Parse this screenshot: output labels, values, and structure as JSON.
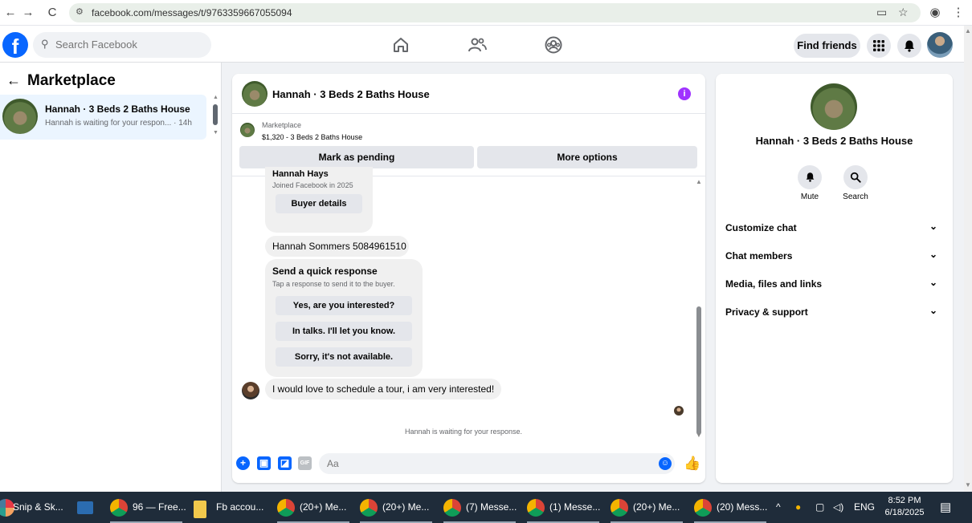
{
  "browser": {
    "url": "facebook.com/messages/t/9763359667055094"
  },
  "header": {
    "search_placeholder": "Search Facebook",
    "find_friends_label": "Find friends"
  },
  "sidebar": {
    "title": "Marketplace",
    "conversations": [
      {
        "name": "Hannah · 3 Beds 2 Baths House",
        "preview": "Hannah is waiting for your respon... · 14h"
      }
    ]
  },
  "chat": {
    "title": "Hannah · 3 Beds 2 Baths House",
    "marketplace_label": "Marketplace",
    "listing": "$1,320 - 3 Beds 2 Baths House",
    "mark_pending_label": "Mark as pending",
    "more_options_label": "More options",
    "profile_name": "Hannah Hays",
    "joined_text": "Joined Facebook in 2025",
    "buyer_details_label": "Buyer details",
    "phone_message": "Hannah Sommers 5084961510",
    "quick_title": "Send a quick response",
    "quick_subtitle": "Tap a response to send it to the buyer.",
    "quick_responses": [
      "Yes, are you interested?",
      "In talks. I'll let you know.",
      "Sorry, it's not available."
    ],
    "incoming_message": "I would love to schedule a tour, i am very interested!",
    "waiting_text": "Hannah is waiting for your response.",
    "composer_placeholder": "Aa",
    "gif_label": "GIF"
  },
  "right_panel": {
    "name": "Hannah · 3 Beds 2 Baths House",
    "mute_label": "Mute",
    "search_label": "Search",
    "sections": [
      "Customize chat",
      "Chat members",
      "Media, files and links",
      "Privacy & support"
    ]
  },
  "taskbar": {
    "items": [
      "Snip & Sk...",
      "96 — Free...",
      "Fb accou...",
      "(20+) Me...",
      "(20+) Me...",
      "(7) Messe...",
      "(1) Messe...",
      "(20+) Me...",
      "(20) Mess..."
    ],
    "language": "ENG",
    "time": "8:52 PM",
    "date": "6/18/2025"
  },
  "colors": {
    "fb_blue": "#0866ff",
    "info_purple": "#a033ff",
    "taskbar_bg": "#1f2c3a"
  }
}
